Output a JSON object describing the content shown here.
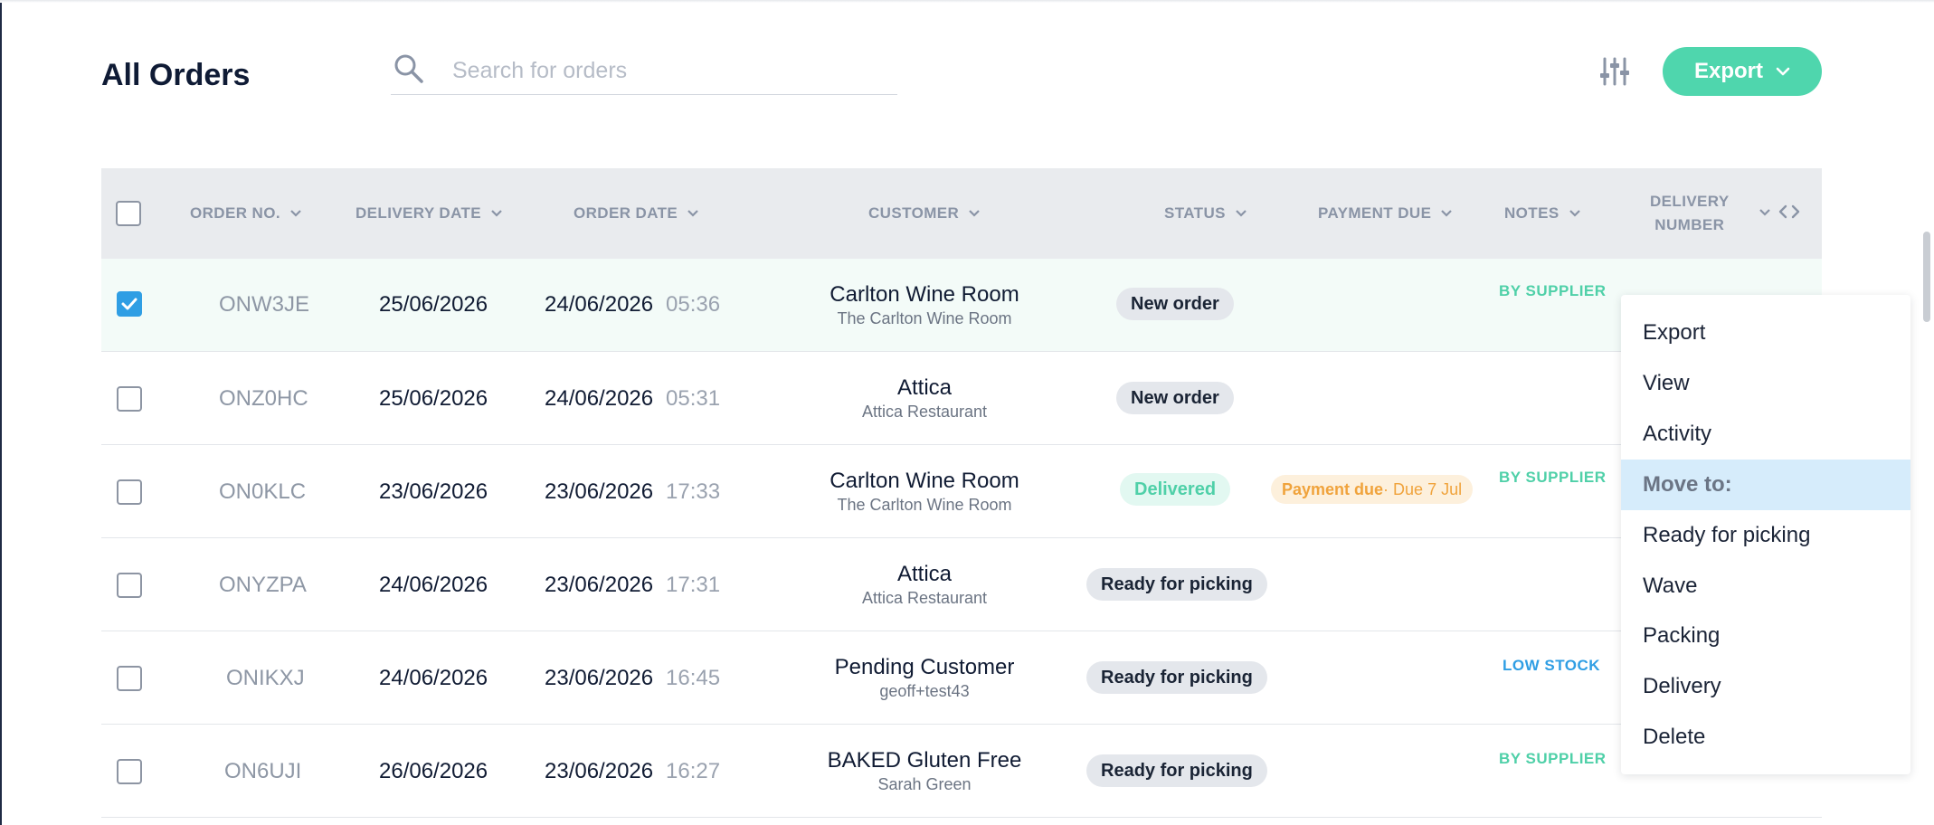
{
  "title": "All Orders",
  "search": {
    "placeholder": "Search for orders",
    "value": ""
  },
  "export_label": "Export",
  "columns": [
    {
      "label": "ORDER NO."
    },
    {
      "label": "DELIVERY DATE"
    },
    {
      "label": "ORDER DATE"
    },
    {
      "label": "CUSTOMER"
    },
    {
      "label": "STATUS"
    },
    {
      "label": "PAYMENT DUE"
    },
    {
      "label": "NOTES"
    },
    {
      "label_line1": "DELIVERY",
      "label_line2": "NUMBER"
    }
  ],
  "rows": [
    {
      "checked": true,
      "order_no": "ONW3JE",
      "delivery_date": "25/06/2026",
      "order_date": "24/06/2026",
      "order_time": "05:36",
      "customer": "Carlton Wine Room",
      "customer_sub": "The Carlton Wine Room",
      "status": "New order",
      "note": "BY SUPPLIER"
    },
    {
      "checked": false,
      "order_no": "ONZ0HC",
      "delivery_date": "25/06/2026",
      "order_date": "24/06/2026",
      "order_time": "05:31",
      "customer": "Attica",
      "customer_sub": "Attica Restaurant",
      "status": "New order",
      "note": ""
    },
    {
      "checked": false,
      "order_no": "ON0KLC",
      "delivery_date": "23/06/2026",
      "order_date": "23/06/2026",
      "order_time": "17:33",
      "customer": "Carlton Wine Room",
      "customer_sub": "The Carlton Wine Room",
      "status": "Delivered",
      "payment_label": "Payment due",
      "payment_detail": " · Due 7 Jul",
      "note": "BY SUPPLIER"
    },
    {
      "checked": false,
      "order_no": "ONYZPA",
      "delivery_date": "24/06/2026",
      "order_date": "23/06/2026",
      "order_time": "17:31",
      "customer": "Attica",
      "customer_sub": "Attica Restaurant",
      "status": "Ready for picking",
      "note": ""
    },
    {
      "checked": false,
      "order_no": "ONIKXJ",
      "delivery_date": "24/06/2026",
      "order_date": "23/06/2026",
      "order_time": "16:45",
      "customer": "Pending Customer",
      "customer_sub": "geoff+test43",
      "status": "Ready for picking",
      "note": "LOW STOCK"
    },
    {
      "checked": false,
      "order_no": "ON6UJI",
      "delivery_date": "26/06/2026",
      "order_date": "23/06/2026",
      "order_time": "16:27",
      "customer": "BAKED Gluten Free",
      "customer_sub": "Sarah Green",
      "status": "Ready for picking",
      "note": "BY SUPPLIER"
    }
  ],
  "context_menu": {
    "items": [
      "Export",
      "View",
      "Activity",
      "Move to:",
      "Ready for picking",
      "Wave",
      "Packing",
      "Delivery",
      "Delete"
    ]
  },
  "colors": {
    "accent": "#4fd6ad",
    "checkbox": "#2f9ee4",
    "payment": "#f0a33c"
  }
}
